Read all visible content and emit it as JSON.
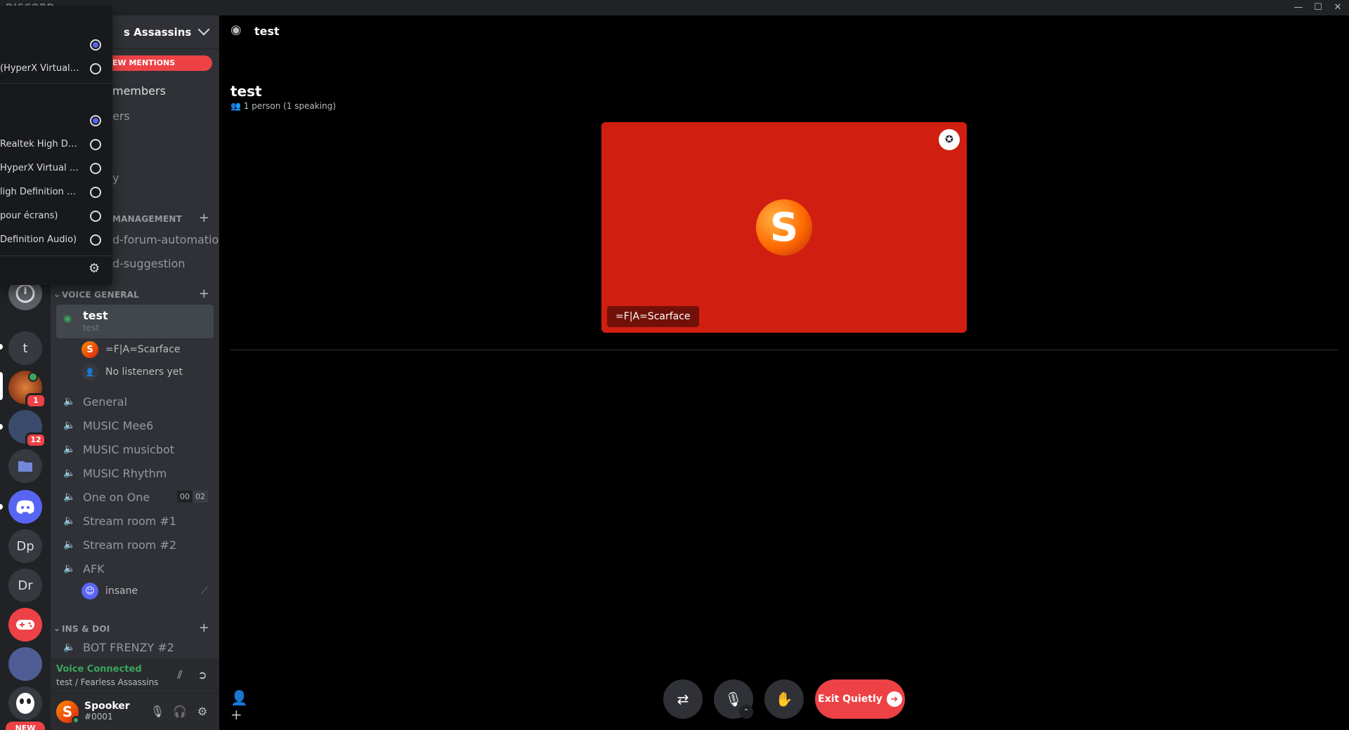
{
  "titlebar": {
    "brand": "DISCORD",
    "minimize": "—",
    "maximize": "☐",
    "close": "✕"
  },
  "guilds": [
    {
      "label": "",
      "kind": "image",
      "color": "#5c5f66"
    },
    {
      "label": "t",
      "kind": "text",
      "color": "#36393f"
    },
    {
      "label": "",
      "kind": "image",
      "color": "#8b2e12",
      "badge": "1"
    },
    {
      "label": "",
      "kind": "image",
      "color": "#3a4a6b",
      "badge": "12"
    },
    {
      "label": "",
      "kind": "folder",
      "color": "#36393f"
    },
    {
      "label": "",
      "kind": "discord",
      "color": "#5865f2"
    },
    {
      "label": "Dp",
      "kind": "text",
      "color": "#36393f"
    },
    {
      "label": "Dr",
      "kind": "text",
      "color": "#36393f"
    },
    {
      "label": "",
      "kind": "gamepad",
      "color": "#ed4245"
    },
    {
      "label": "",
      "kind": "image",
      "color": "#4e5d94"
    },
    {
      "label": "",
      "kind": "image",
      "color": "#36393f"
    },
    {
      "label": "NEW",
      "kind": "new",
      "color": "#ed4245"
    }
  ],
  "sidebar": {
    "server_name": "s Assassins",
    "mentions": "EW MENTIONS",
    "partial_items": [
      "members",
      "ers",
      "y"
    ],
    "category_management": "MANAGEMENT",
    "management_channels": [
      "d-forum-automation",
      "d-suggestion"
    ],
    "category_voice": "VOICE GENERAL",
    "active_channel": {
      "name": "test",
      "topic": "test"
    },
    "stage_users": [
      {
        "name": "=F|A=Scarface",
        "avatar": "S"
      },
      {
        "name": "No listeners yet",
        "avatar": "👤"
      }
    ],
    "voice_channels": [
      "General",
      "MUSIC Mee6",
      "MUSIC musicbot",
      "MUSIC Rhythm",
      "One on One",
      "Stream room #1",
      "Stream room #2",
      "AFK"
    ],
    "one_on_one_limit": [
      "00",
      "02"
    ],
    "afk_user": "insane",
    "category_ins": "INS & DOI",
    "last_channel": "BOT FRENZY #2"
  },
  "voice_panel": {
    "status": "Voice Connected",
    "location": "test / Fearless Assassins"
  },
  "user_panel": {
    "name": "Spooker",
    "tag": "#0001",
    "avatar": "S"
  },
  "flyout": {
    "input_items": [
      {
        "label": "",
        "selected": true
      },
      {
        "label": "(HyperX Virtual S...",
        "selected": false
      }
    ],
    "output_items": [
      {
        "label": "",
        "selected": true
      },
      {
        "label": "Realtek High Defin...",
        "selected": false
      },
      {
        "label": "HyperX Virtual Su...",
        "selected": false
      },
      {
        "label": "ligh Definition Au...",
        "selected": false
      },
      {
        "label": "pour écrans)",
        "selected": false
      },
      {
        "label": "Definition Audio)",
        "selected": false
      }
    ],
    "settings_icon": "gear-icon"
  },
  "main": {
    "header_title": "test",
    "stage_title": "test",
    "stage_sub": "1 person (1 speaking)",
    "speaker_name": "=F|A=Scarface",
    "speaker_avatar": "S",
    "exit_label": "Exit Quietly"
  },
  "colors": {
    "accent": "#5865f2",
    "danger": "#ed4245",
    "online": "#3ba55d",
    "tile": "#d01f10"
  }
}
